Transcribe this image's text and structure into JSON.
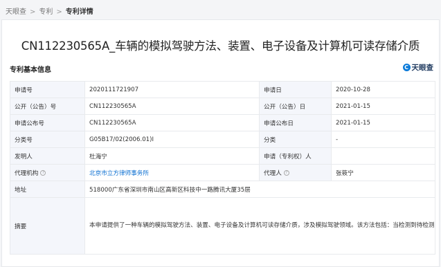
{
  "breadcrumb": {
    "home": "天眼查",
    "section": "专利",
    "current": "专利详情"
  },
  "patent": {
    "title": "CN112230565A_车辆的模拟驾驶方法、装置、电子设备及计算机可读存储介质"
  },
  "section_title": "专利基本信息",
  "brand": {
    "logo_char": "C",
    "name": "天眼查"
  },
  "fields": {
    "app_no_label": "申请号",
    "app_no": "2020111721907",
    "app_date_label": "申请日",
    "app_date": "2020-10-28",
    "pub_no_label": "公开（公告）号",
    "pub_no": "CN112230565A",
    "pub_date_label": "公开（公告）日",
    "pub_date": "2021-01-15",
    "app_pub_no_label": "申请公布号",
    "app_pub_no": "CN112230565A",
    "app_pub_date_label": "申请公布日",
    "app_pub_date": "2021-01-15",
    "class_no_label": "分类号",
    "class_no": "G05B17/02(2006.01)I",
    "class_label": "分类",
    "class_value": "-",
    "inventor_label": "发明人",
    "inventor": "杜海宁",
    "applicant_label": "申请（专利权）人",
    "applicant": "",
    "agency_label": "代理机构",
    "agency": "北京市立方律师事务所",
    "agent_label": "代理人",
    "agent": "张筱宁",
    "address_label": "地址",
    "address": "518000广东省深圳市南山区高新区科技中一路腾讯大厦35层",
    "abstract_label": "摘要",
    "abstract": "本申请提供了一种车辆的模拟驾驶方法、装置、电子设备及计算机可读存储介质，涉及模拟驾驶领域。该方法包括：当检测到待检测车辆处于目标车辆的当前避让区域时，获取所述当前避让区域对应的当前方位；获取所述待检测车辆的预设行驶参数以及所述当前方位对应的目标行驶参数；基于所述预设行驶参数与所述目标行驶参数的对比结果，确定出对应的行驶策略，以便得所述待检测车辆执行所述行驶策略脱离所述当前避让区域。本申请提高了模拟驾驶的真实性和准确性。"
  }
}
